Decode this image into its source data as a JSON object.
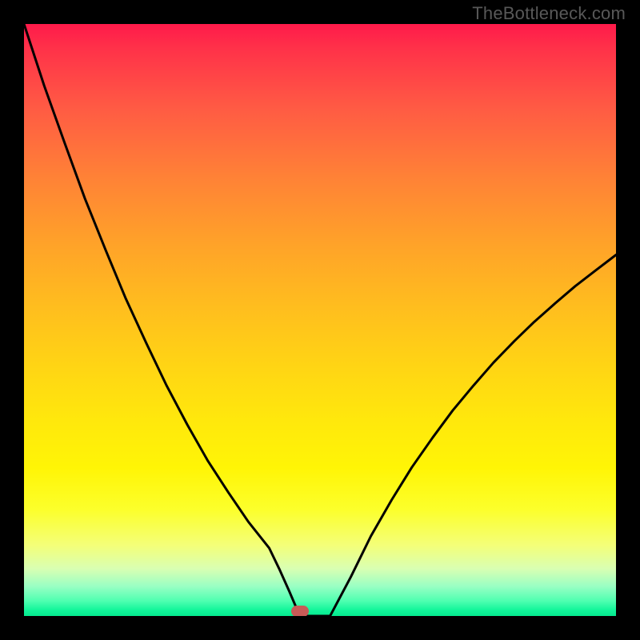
{
  "watermark": "TheBottleneck.com",
  "chart_data": {
    "type": "line",
    "title": "",
    "xlabel": "",
    "ylabel": "",
    "xlim": [
      0,
      100
    ],
    "ylim": [
      0,
      100
    ],
    "grid": false,
    "legend": false,
    "gradient_stops": [
      {
        "pct": 0,
        "color": "#ff1a4a"
      },
      {
        "pct": 4,
        "color": "#ff3149"
      },
      {
        "pct": 14,
        "color": "#ff5a44"
      },
      {
        "pct": 26,
        "color": "#ff8236"
      },
      {
        "pct": 37,
        "color": "#ffa229"
      },
      {
        "pct": 48,
        "color": "#ffbe1e"
      },
      {
        "pct": 58,
        "color": "#ffd514"
      },
      {
        "pct": 67,
        "color": "#ffe80c"
      },
      {
        "pct": 75,
        "color": "#fff506"
      },
      {
        "pct": 82,
        "color": "#fcff2b"
      },
      {
        "pct": 88,
        "color": "#f4ff78"
      },
      {
        "pct": 92,
        "color": "#d9ffb2"
      },
      {
        "pct": 95,
        "color": "#99ffc4"
      },
      {
        "pct": 97.5,
        "color": "#4dffb0"
      },
      {
        "pct": 99,
        "color": "#12f59a"
      },
      {
        "pct": 100,
        "color": "#05e98f"
      }
    ],
    "series": [
      {
        "name": "bottleneck-curve",
        "x": [
          0.0,
          3.4,
          6.9,
          10.3,
          13.8,
          17.2,
          20.7,
          24.1,
          27.6,
          31.0,
          34.5,
          37.9,
          41.4,
          43.1,
          44.8,
          46.6,
          51.7,
          55.2,
          58.6,
          62.1,
          65.5,
          69.0,
          72.4,
          75.9,
          79.3,
          82.8,
          86.2,
          89.7,
          93.1,
          96.6,
          100.0
        ],
        "y": [
          100.0,
          89.6,
          79.8,
          70.5,
          61.8,
          53.6,
          46.0,
          38.9,
          32.3,
          26.3,
          20.9,
          15.9,
          11.5,
          8.0,
          4.2,
          0.0,
          0.0,
          6.6,
          13.5,
          19.6,
          25.1,
          30.1,
          34.7,
          38.9,
          42.8,
          46.4,
          49.7,
          52.8,
          55.7,
          58.4,
          61.0
        ]
      }
    ],
    "marker": {
      "x": 46.6,
      "y": 0.0,
      "color": "#c85a57"
    },
    "notes": "V-shaped bottleneck curve over vertical thermal gradient; minimum at x≈46.6"
  }
}
